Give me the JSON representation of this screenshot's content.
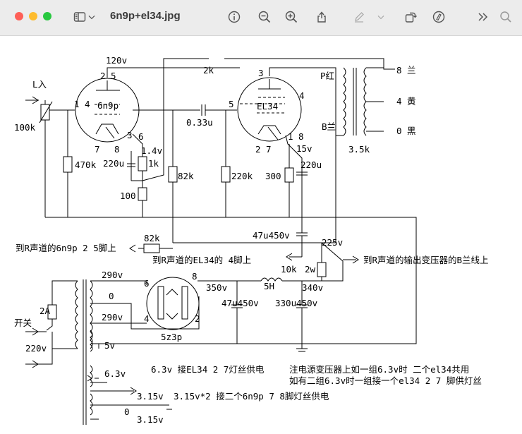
{
  "window": {
    "title": "6n9p+el34.jpg",
    "toolbar_icons": [
      "sidebar-icon",
      "chevron-down-icon",
      "info-icon",
      "zoom-out-icon",
      "zoom-in-icon",
      "share-icon",
      "markup-pen-icon",
      "chevron-down-icon",
      "rotate-icon",
      "annotate-icon",
      "more-icon",
      "search-icon"
    ]
  },
  "diagram": {
    "tube1": {
      "name": "6n9p",
      "pins_top": "2 5",
      "pins_left": "1 4",
      "pins_right": "3",
      "pins_bottom_a": "7",
      "pins_bottom_b": "8",
      "pin6": "6"
    },
    "tube2": {
      "name": "EL34",
      "pin_top": "3",
      "pin_right": "4",
      "pin_grid": "5",
      "pins_bottom": "2 7",
      "pins_cathode": "1 8"
    },
    "rectifier": {
      "name": "5z3p",
      "pin_a": "6",
      "pin_b": "8",
      "pin_c": "4",
      "pin_d": "2"
    },
    "labels": {
      "input": "L入",
      "vol": "100k",
      "r_grid": "470k",
      "v_plate": "120v",
      "r_plate": "2k",
      "cap_couple": "0.33u",
      "v_cath1": "1.4v",
      "r_cath1": "1k",
      "c_cath1": "220u",
      "r_fb": "100",
      "r_82k_a": "82k",
      "r_220k": "220k",
      "v_cath2": "15v",
      "r_cath2": "300",
      "c_cath2": "220u",
      "c_filter1": "47u450v",
      "r_82k_b": "82k",
      "v_225": "225v",
      "r_10k": "10k",
      "w_2w": "2w",
      "to_r_6n9p": "到R声道的6n9p 2 5脚上",
      "to_r_el34": "到R声道的EL34的 4脚上",
      "to_r_trans": "到R声道的输出变压器的B兰线上",
      "ot_p": "P红",
      "ot_b": "B兰",
      "ot_impedance": "3.5k",
      "tap8": "8 兰",
      "tap4": "4 黄",
      "tap0": "0 黑",
      "v290a": "290v",
      "v0": "0",
      "v290b": "290v",
      "v5": "5v",
      "v350": "350v",
      "choke": "5H",
      "v340": "340v",
      "c_filter2": "47u450v",
      "c_filter3": "330u450v",
      "fuse": "2A",
      "switch": "开关",
      "mains": "220v",
      "w63": "6.3v",
      "note1": "6.3v 接EL34 2 7灯丝供电",
      "note2": "注电源变压器上如一组6.3v时 二个el34共用",
      "note3": "如有二组6.3v时一组接一个el34 2 7 脚供灯丝",
      "w315a": "3.15v",
      "note4": "3.15v*2 接二个6n9p 7 8脚灯丝供电",
      "w0": "0",
      "w315b": "3.15v"
    }
  }
}
